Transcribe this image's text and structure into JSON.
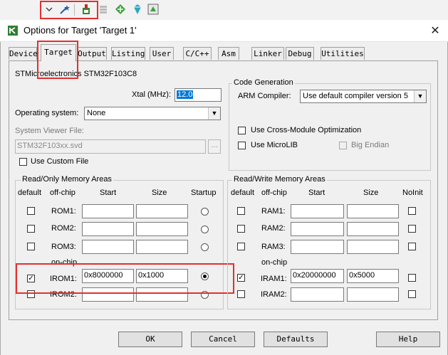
{
  "window": {
    "title": "Options for Target 'Target 1'"
  },
  "tabs": [
    {
      "label": "Device"
    },
    {
      "label": "Target"
    },
    {
      "label": "Output"
    },
    {
      "label": "Listing"
    },
    {
      "label": "User"
    },
    {
      "label": "C/C++"
    },
    {
      "label": "Asm"
    },
    {
      "label": "Linker"
    },
    {
      "label": "Debug"
    },
    {
      "label": "Utilities"
    }
  ],
  "device_name": "STMicroelectronics STM32F103C8",
  "xtal": {
    "label": "Xtal (MHz):",
    "value": "12.0"
  },
  "os": {
    "label": "Operating system:",
    "value": "None"
  },
  "svd": {
    "label": "System Viewer File:",
    "value": "STM32F103xx.svd",
    "browse": "..."
  },
  "custom_file": {
    "label": "Use Custom File"
  },
  "codegen": {
    "title": "Code Generation",
    "compiler_label": "ARM Compiler:",
    "compiler_value": "Use default compiler version 5",
    "cross_module": "Use Cross-Module Optimization",
    "microlib": "Use MicroLIB",
    "big_endian": "Big Endian"
  },
  "rom": {
    "title": "Read/Only Memory Areas",
    "headers": {
      "default": "default",
      "offchip": "off-chip",
      "start": "Start",
      "size": "Size",
      "startup": "Startup"
    },
    "onchip": "on-chip",
    "rows": [
      {
        "name": "ROM1:",
        "start": "",
        "size": ""
      },
      {
        "name": "ROM2:",
        "start": "",
        "size": ""
      },
      {
        "name": "ROM3:",
        "start": "",
        "size": ""
      },
      {
        "name": "IROM1:",
        "start": "0x8000000",
        "size": "0x1000"
      },
      {
        "name": "IROM2:",
        "start": "",
        "size": ""
      }
    ]
  },
  "ram": {
    "title": "Read/Write Memory Areas",
    "headers": {
      "default": "default",
      "offchip": "off-chip",
      "start": "Start",
      "size": "Size",
      "noinit": "NoInit"
    },
    "onchip": "on-chip",
    "rows": [
      {
        "name": "RAM1:",
        "start": "",
        "size": ""
      },
      {
        "name": "RAM2:",
        "start": "",
        "size": ""
      },
      {
        "name": "RAM3:",
        "start": "",
        "size": ""
      },
      {
        "name": "IRAM1:",
        "start": "0x20000000",
        "size": "0x5000"
      },
      {
        "name": "IRAM2:",
        "start": "",
        "size": ""
      }
    ]
  },
  "buttons": {
    "ok": "OK",
    "cancel": "Cancel",
    "defaults": "Defaults",
    "help": "Help"
  },
  "colors": {
    "highlight": "#e23030",
    "selection": "#0078d7",
    "dialog_bg": "#f0f0f0"
  }
}
